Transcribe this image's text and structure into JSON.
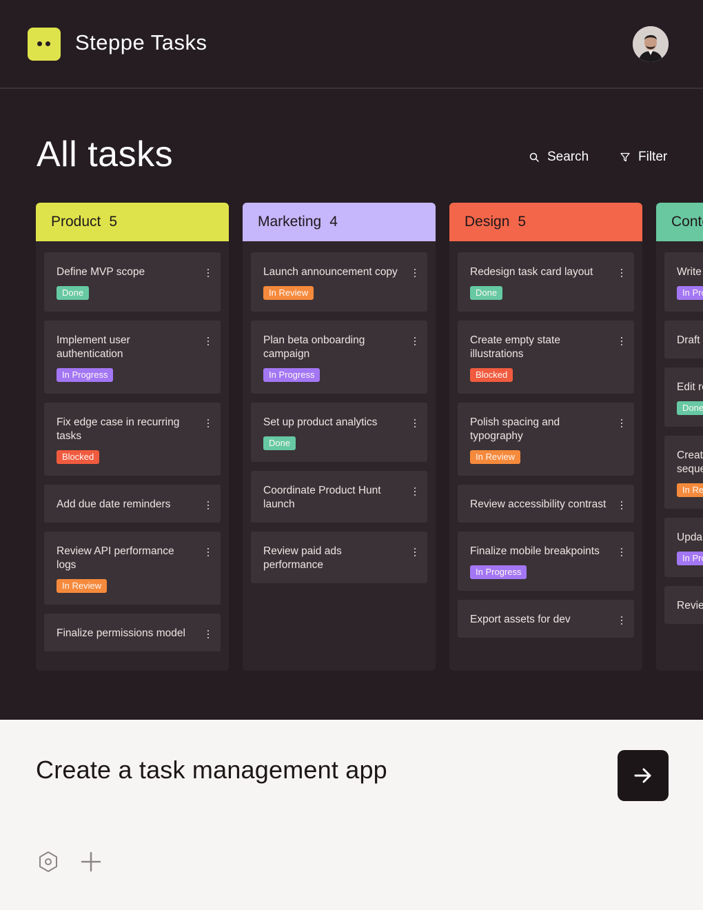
{
  "app": {
    "name": "Steppe Tasks"
  },
  "page": {
    "title": "All tasks"
  },
  "toolbar": {
    "search_label": "Search",
    "filter_label": "Filter"
  },
  "colors": {
    "product": "#dfe34b",
    "marketing": "#c6b6fb",
    "design": "#f4664a",
    "content": "#69c8a0",
    "done": "#66c9a3",
    "in_review": "#f58a3c",
    "in_progress": "#a377f4",
    "blocked": "#f05b3f"
  },
  "columns": [
    {
      "name": "Product",
      "count": "5",
      "tasks": [
        {
          "title": "Define MVP scope",
          "status": "Done"
        },
        {
          "title": "Implement user authentication",
          "status": "In Progress"
        },
        {
          "title": "Fix edge case in recurring tasks",
          "status": "Blocked"
        },
        {
          "title": "Add due date reminders",
          "status": ""
        },
        {
          "title": "Review API performance logs",
          "status": "In Review"
        },
        {
          "title": "Finalize permissions model",
          "status": ""
        }
      ]
    },
    {
      "name": "Marketing",
      "count": "4",
      "tasks": [
        {
          "title": "Launch announcement copy",
          "status": "In Review"
        },
        {
          "title": "Plan beta onboarding campaign",
          "status": "In Progress"
        },
        {
          "title": "Set up product analytics",
          "status": "Done"
        },
        {
          "title": "Coordinate Product Hunt launch",
          "status": ""
        },
        {
          "title": "Review paid ads performance",
          "status": ""
        }
      ]
    },
    {
      "name": "Design",
      "count": "5",
      "tasks": [
        {
          "title": "Redesign task card layout",
          "status": "Done"
        },
        {
          "title": "Create empty state illustrations",
          "status": "Blocked"
        },
        {
          "title": "Polish spacing and typography",
          "status": "In Review"
        },
        {
          "title": "Review accessibility contrast",
          "status": ""
        },
        {
          "title": "Finalize mobile breakpoints",
          "status": "In Progress"
        },
        {
          "title": "Export assets for dev",
          "status": ""
        }
      ]
    },
    {
      "name": "Conte",
      "count": "",
      "tasks": [
        {
          "title": "Write",
          "status": "In Pro"
        },
        {
          "title": "Draft",
          "status": ""
        },
        {
          "title": "Edit re",
          "status": "Done"
        },
        {
          "title": "Creat seque",
          "status": "In Re"
        },
        {
          "title": "Upda",
          "status": "In Pro"
        },
        {
          "title": "Revie",
          "status": ""
        }
      ]
    }
  ],
  "prompt": {
    "text": "Create a task management app"
  },
  "icons": {
    "search": "search-icon",
    "filter": "filter-icon",
    "send": "arrow-right-icon",
    "settings": "settings-icon",
    "add": "plus-icon"
  }
}
